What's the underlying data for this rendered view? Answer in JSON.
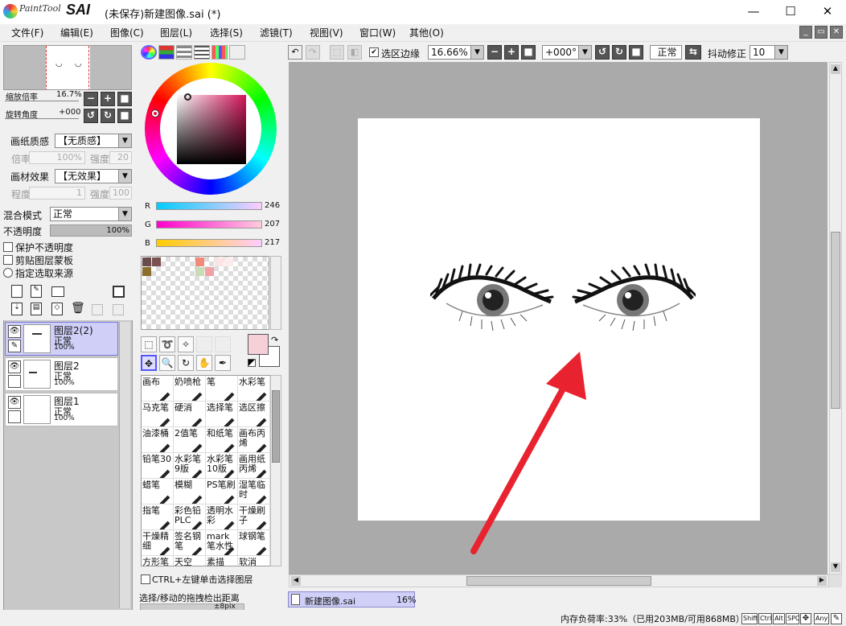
{
  "app": {
    "logo_text": "PaintTool",
    "logo_brand": "SAI",
    "window_title": "(未保存)新建图像.sai (*)",
    "minimize": "—",
    "maximize": "☐",
    "close": "✕"
  },
  "menu": [
    "文件(F)",
    "编辑(E)",
    "图像(C)",
    "图层(L)",
    "选择(S)",
    "滤镜(T)",
    "视图(V)",
    "窗口(W)",
    "其他(O)"
  ],
  "navigator": {
    "zoom_label": "缩放倍率",
    "zoom_value": "16.7%",
    "rotate_label": "旋转角度",
    "rotate_value": "+000"
  },
  "texture": {
    "paper_label": "画纸质感",
    "paper_value": "【无质感】",
    "paper_rate_label": "倍率",
    "paper_rate_value": "100%",
    "paper_strength_label": "强度",
    "paper_strength_value": "20",
    "effect_label": "画材效果",
    "effect_value": "【无效果】",
    "effect_level_label": "程度",
    "effect_level_value": "1",
    "effect_strength_label": "强度",
    "effect_strength_value": "100"
  },
  "layer_props": {
    "blend_label": "混合模式",
    "blend_value": "正常",
    "opacity_label": "不透明度",
    "opacity_value": "100%",
    "preserve_opacity": "保护不透明度",
    "clipping": "剪贴图层蒙板",
    "selection_source": "指定选取来源"
  },
  "layers": [
    {
      "name": "图层2(2)",
      "mode": "正常",
      "opacity": "100%",
      "selected": true
    },
    {
      "name": "图层2",
      "mode": "正常",
      "opacity": "100%",
      "selected": false
    },
    {
      "name": "图层1",
      "mode": "正常",
      "opacity": "100%",
      "selected": false
    }
  ],
  "color": {
    "r_label": "R",
    "r_value": "246",
    "g_label": "G",
    "g_value": "207",
    "b_label": "B",
    "b_value": "217",
    "primary": "#f6cfd9",
    "secondary": "#ffffff"
  },
  "swatches": [
    "#6b4c4c",
    "#7a5050",
    "#8c6e2c",
    "#f28a7a",
    "#fce4e4",
    "#fdecec",
    "#c8dcb8",
    "#f2a0a6",
    "#fff0f0"
  ],
  "brushes": [
    [
      "画布",
      "奶喷枪",
      "笔",
      "水彩笔"
    ],
    [
      "马克笔",
      "硬消",
      "选择笔",
      "选区擦"
    ],
    [
      "油漆桶",
      "2值笔",
      "和纸笔",
      "画布丙烯"
    ],
    [
      "铅笔30",
      "水彩笔9版",
      "水彩笔10版",
      "画用纸丙烯"
    ],
    [
      "蜡笔",
      "模糊",
      "PS笔刷",
      "湿笔临时"
    ],
    [
      "指笔",
      "彩色铅PLC",
      "透明水彩",
      "干燥刷子"
    ],
    [
      "干燥精细",
      "签名钢笔",
      "mark笔水性",
      "球钢笔"
    ],
    [
      "方形笔",
      "天空",
      "素描",
      "软消"
    ]
  ],
  "ctrl_click_label": "CTRL+左键单击选择图层",
  "drag_label": "选择/移动的拖拽检出距离",
  "drag_value": "±8pix",
  "canvas_toolbar": {
    "select_edge_label": "选区边缘",
    "select_edge_checked": true,
    "zoom_value": "16.66%",
    "rotate_value": "+000°",
    "blend_value": "正常",
    "stabilizer_label": "抖动修正",
    "stabilizer_value": "10"
  },
  "document_tab": {
    "name": "新建图像.sai",
    "zoom": "16%"
  },
  "status": {
    "memory": "内存负荷率:33%（已用203MB/可用868MB）",
    "keys": [
      "Shift",
      "Ctrl",
      "Alt",
      "SPC",
      "Any"
    ]
  },
  "annotation_color": "#e8232f"
}
